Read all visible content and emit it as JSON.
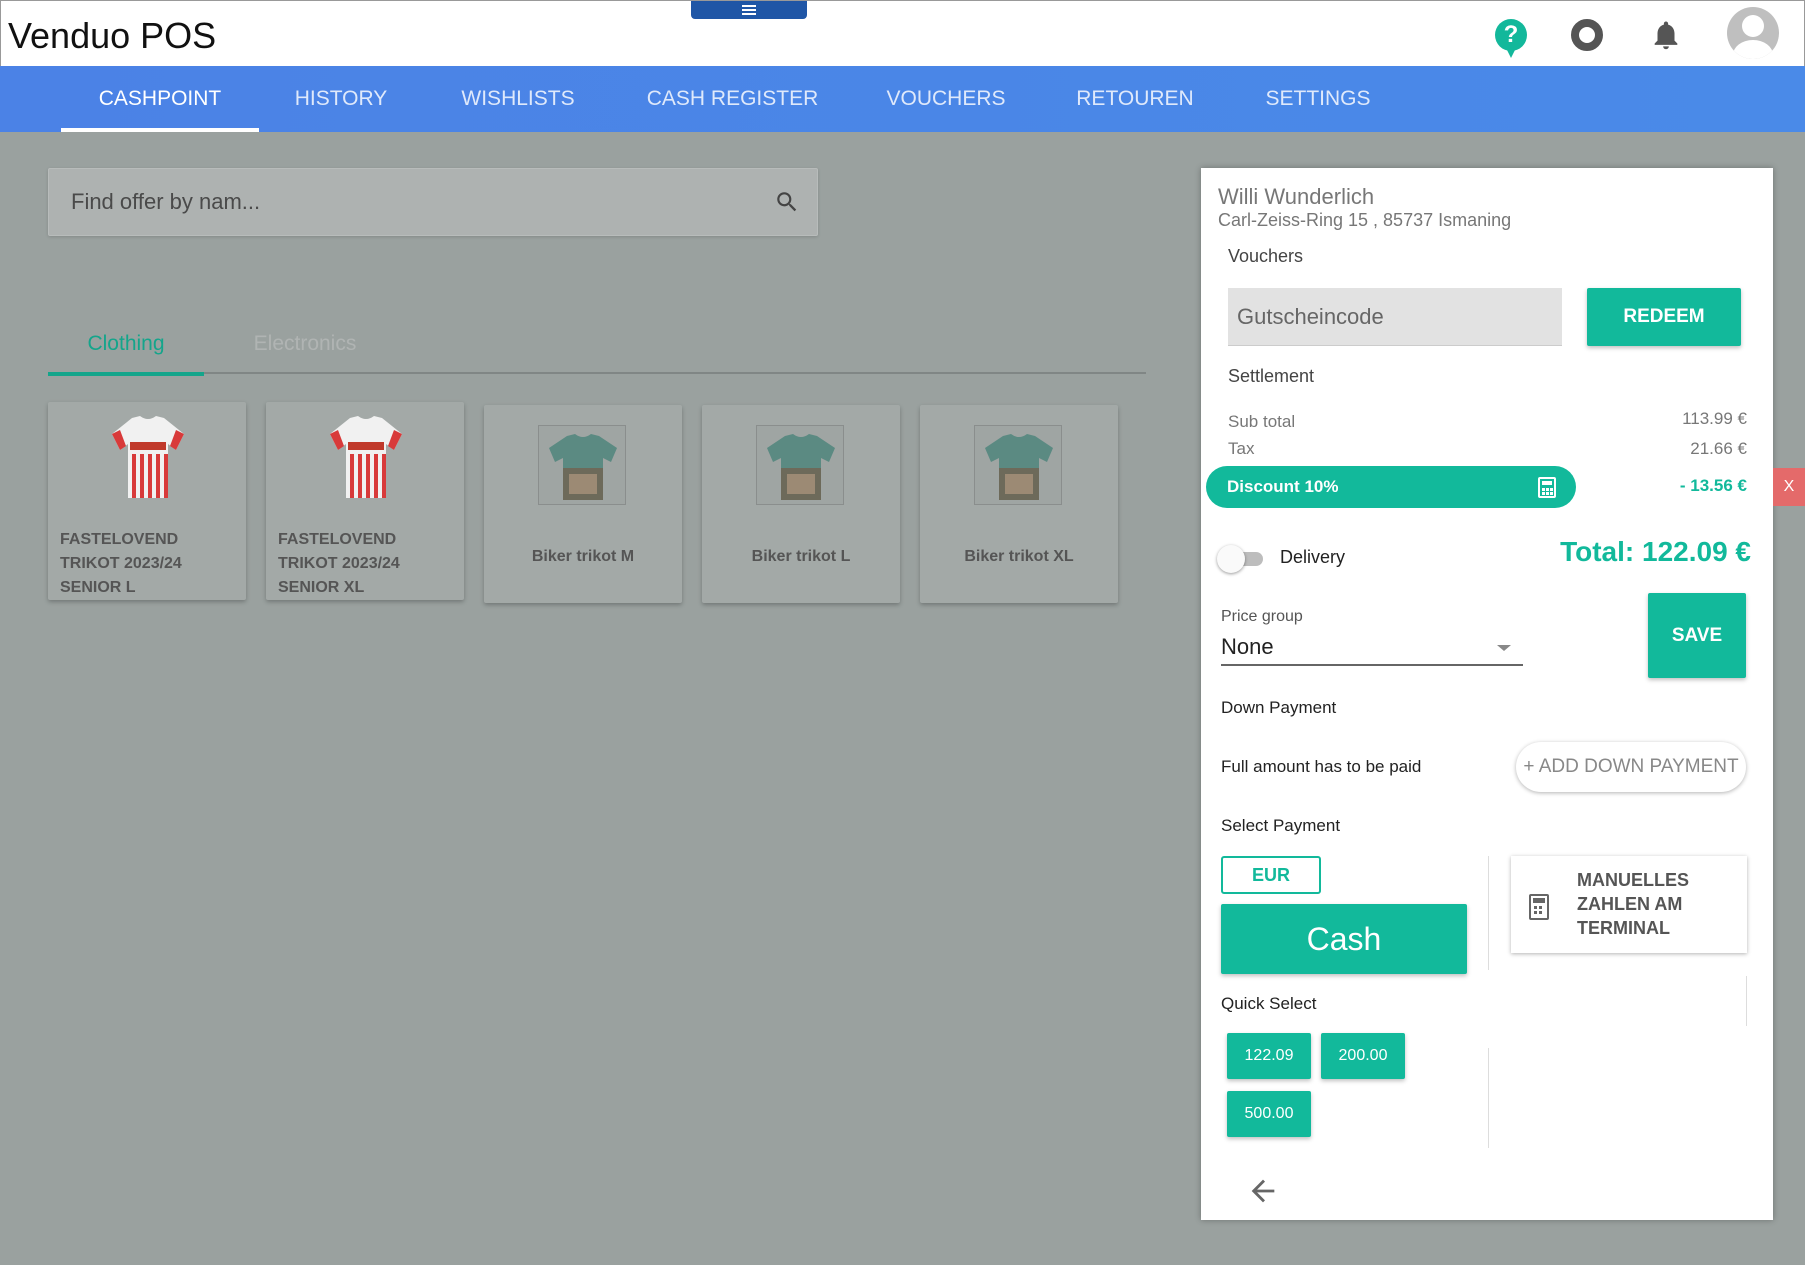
{
  "app": {
    "title": "Venduo POS"
  },
  "nav": {
    "tabs": [
      {
        "label": "CASHPOINT"
      },
      {
        "label": "HISTORY"
      },
      {
        "label": "WISHLISTS"
      },
      {
        "label": "CASH REGISTER"
      },
      {
        "label": "VOUCHERS"
      },
      {
        "label": "RETOUREN"
      },
      {
        "label": "SETTINGS"
      }
    ]
  },
  "search": {
    "placeholder": "Find offer by nam..."
  },
  "categories": [
    {
      "label": "Clothing"
    },
    {
      "label": "Electronics"
    }
  ],
  "products": [
    {
      "name": "FASTELOVEND TRIKOT 2023/24 SENIOR L"
    },
    {
      "name": "FASTELOVEND TRIKOT 2023/24 SENIOR XL"
    },
    {
      "name": "Biker trikot M"
    },
    {
      "name": "Biker trikot L"
    },
    {
      "name": "Biker trikot XL"
    }
  ],
  "cart": {
    "customer_name": "Willi Wunderlich",
    "customer_address": "Carl-Zeiss-Ring 15 , 85737 Ismaning",
    "vouchers_label": "Vouchers",
    "voucher_placeholder": "Gutscheincode",
    "redeem_label": "REDEEM",
    "settlement_label": "Settlement",
    "subtotal_label": "Sub total",
    "subtotal_value": "113.99 €",
    "tax_label": "Tax",
    "tax_value": "21.66 €",
    "discount_label": "Discount 10%",
    "discount_value": "- 13.56 €",
    "remove_label": "X",
    "delivery_label": "Delivery",
    "delivery_enabled": false,
    "total_label": "Total: 122.09 €",
    "price_group_label": "Price group",
    "price_group_value": "None",
    "save_label": "SAVE",
    "down_payment_label": "Down Payment",
    "full_amount_label": "Full amount has to be paid",
    "add_down_payment_label": "+ ADD DOWN PAYMENT",
    "select_payment_label": "Select Payment",
    "currency_label": "EUR",
    "cash_label": "Cash",
    "terminal_label_1": "MANUELLES",
    "terminal_label_2": "ZAHLEN AM",
    "terminal_label_3": "TERMINAL",
    "quick_select_label": "Quick Select",
    "quick_amounts": [
      "122.09",
      "200.00",
      "500.00"
    ]
  },
  "colors": {
    "accent": "#12b99b",
    "nav": "#4b82e6",
    "danger": "#e46a6a"
  }
}
